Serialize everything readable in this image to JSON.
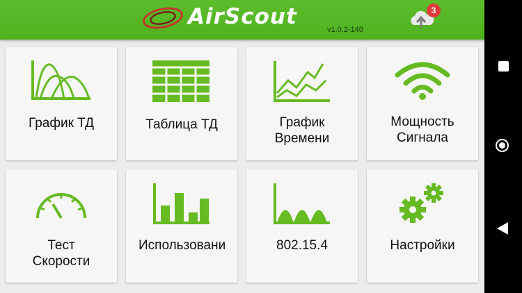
{
  "header": {
    "app_title": "AirScout",
    "version": "v1.0.2-140",
    "notification_count": "3",
    "accent_color": "#5cbd2c"
  },
  "tiles": [
    {
      "label": "График ТД",
      "icon": "ap-graph-icon"
    },
    {
      "label": "Таблица ТД",
      "icon": "ap-table-icon"
    },
    {
      "label": "График\nВремени",
      "icon": "time-graph-icon"
    },
    {
      "label": "Мощность\nСигнала",
      "icon": "wifi-signal-icon"
    },
    {
      "label": "Тест\nСкорости",
      "icon": "speedometer-icon"
    },
    {
      "label": "Использовани",
      "icon": "usage-bars-icon"
    },
    {
      "label": "802.15.4",
      "icon": "spectrum-icon"
    },
    {
      "label": "Настройки",
      "icon": "gears-icon"
    }
  ],
  "system_nav": {
    "icons": [
      "recents-square-icon",
      "home-circle-icon",
      "back-triangle-icon"
    ]
  }
}
